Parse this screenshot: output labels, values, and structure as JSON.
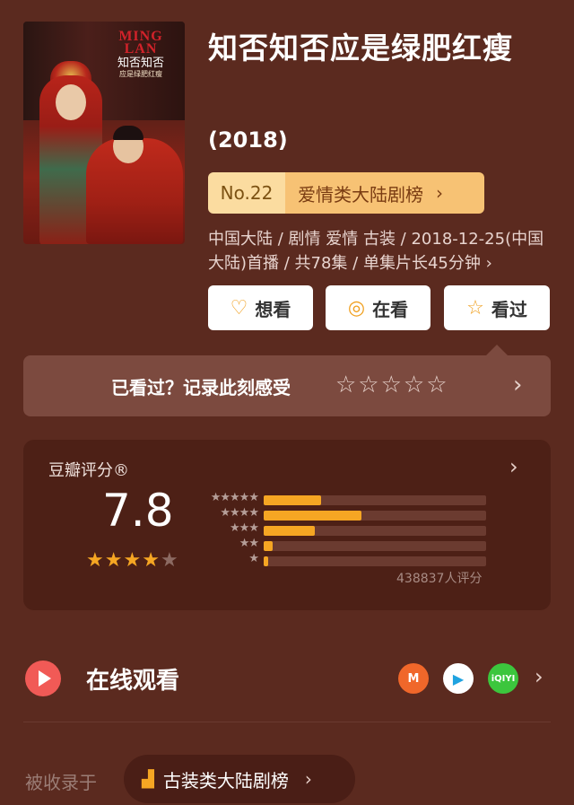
{
  "poster": {
    "logo_en": "MING LAN",
    "logo_cn": "知否知否",
    "logo_sub": "应是绿肥红瘦"
  },
  "title": "知否知否应是绿肥红瘦",
  "year": "(2018)",
  "rank": {
    "number": "No.22",
    "label": "爱情类大陆剧榜",
    "arrow": "›"
  },
  "meta": "中国大陆 / 剧情 爱情 古装 / 2018-12-25(中国大陆)首播 / 共78集 / 单集片长45分钟 ›",
  "actions": [
    {
      "icon": "♡",
      "label": "想看"
    },
    {
      "icon": "◎",
      "label": "在看"
    },
    {
      "icon": "☆",
      "label": "看过"
    }
  ],
  "record": {
    "label": "已看过？记录此刻感受",
    "stars": "☆☆☆☆☆",
    "arrow": "›"
  },
  "rating": {
    "label": "豆瓣评分®",
    "score": "7.8",
    "stars_filled": 4,
    "stars_total": 5,
    "count": "438837人评分",
    "arrow": "›",
    "distribution": [
      {
        "stars": "★★★★★",
        "fraction": 0.26
      },
      {
        "stars": "★★★★",
        "fraction": 0.44
      },
      {
        "stars": "★★★",
        "fraction": 0.23
      },
      {
        "stars": "★★",
        "fraction": 0.04
      },
      {
        "stars": "★",
        "fraction": 0.02
      }
    ]
  },
  "watch": {
    "label": "在线观看",
    "apps": [
      "芒果TV",
      "腾讯视频",
      "iQIYI"
    ],
    "app_glyphs": [
      "M",
      "▶",
      "iQIYI"
    ],
    "arrow": "›"
  },
  "included": {
    "label": "被收录于",
    "chip": "古装类大陆剧榜",
    "arrow": "›"
  },
  "colors": {
    "background": "#5b2a1f",
    "accent": "#f6a623",
    "rank_bg": "#f7c274"
  }
}
